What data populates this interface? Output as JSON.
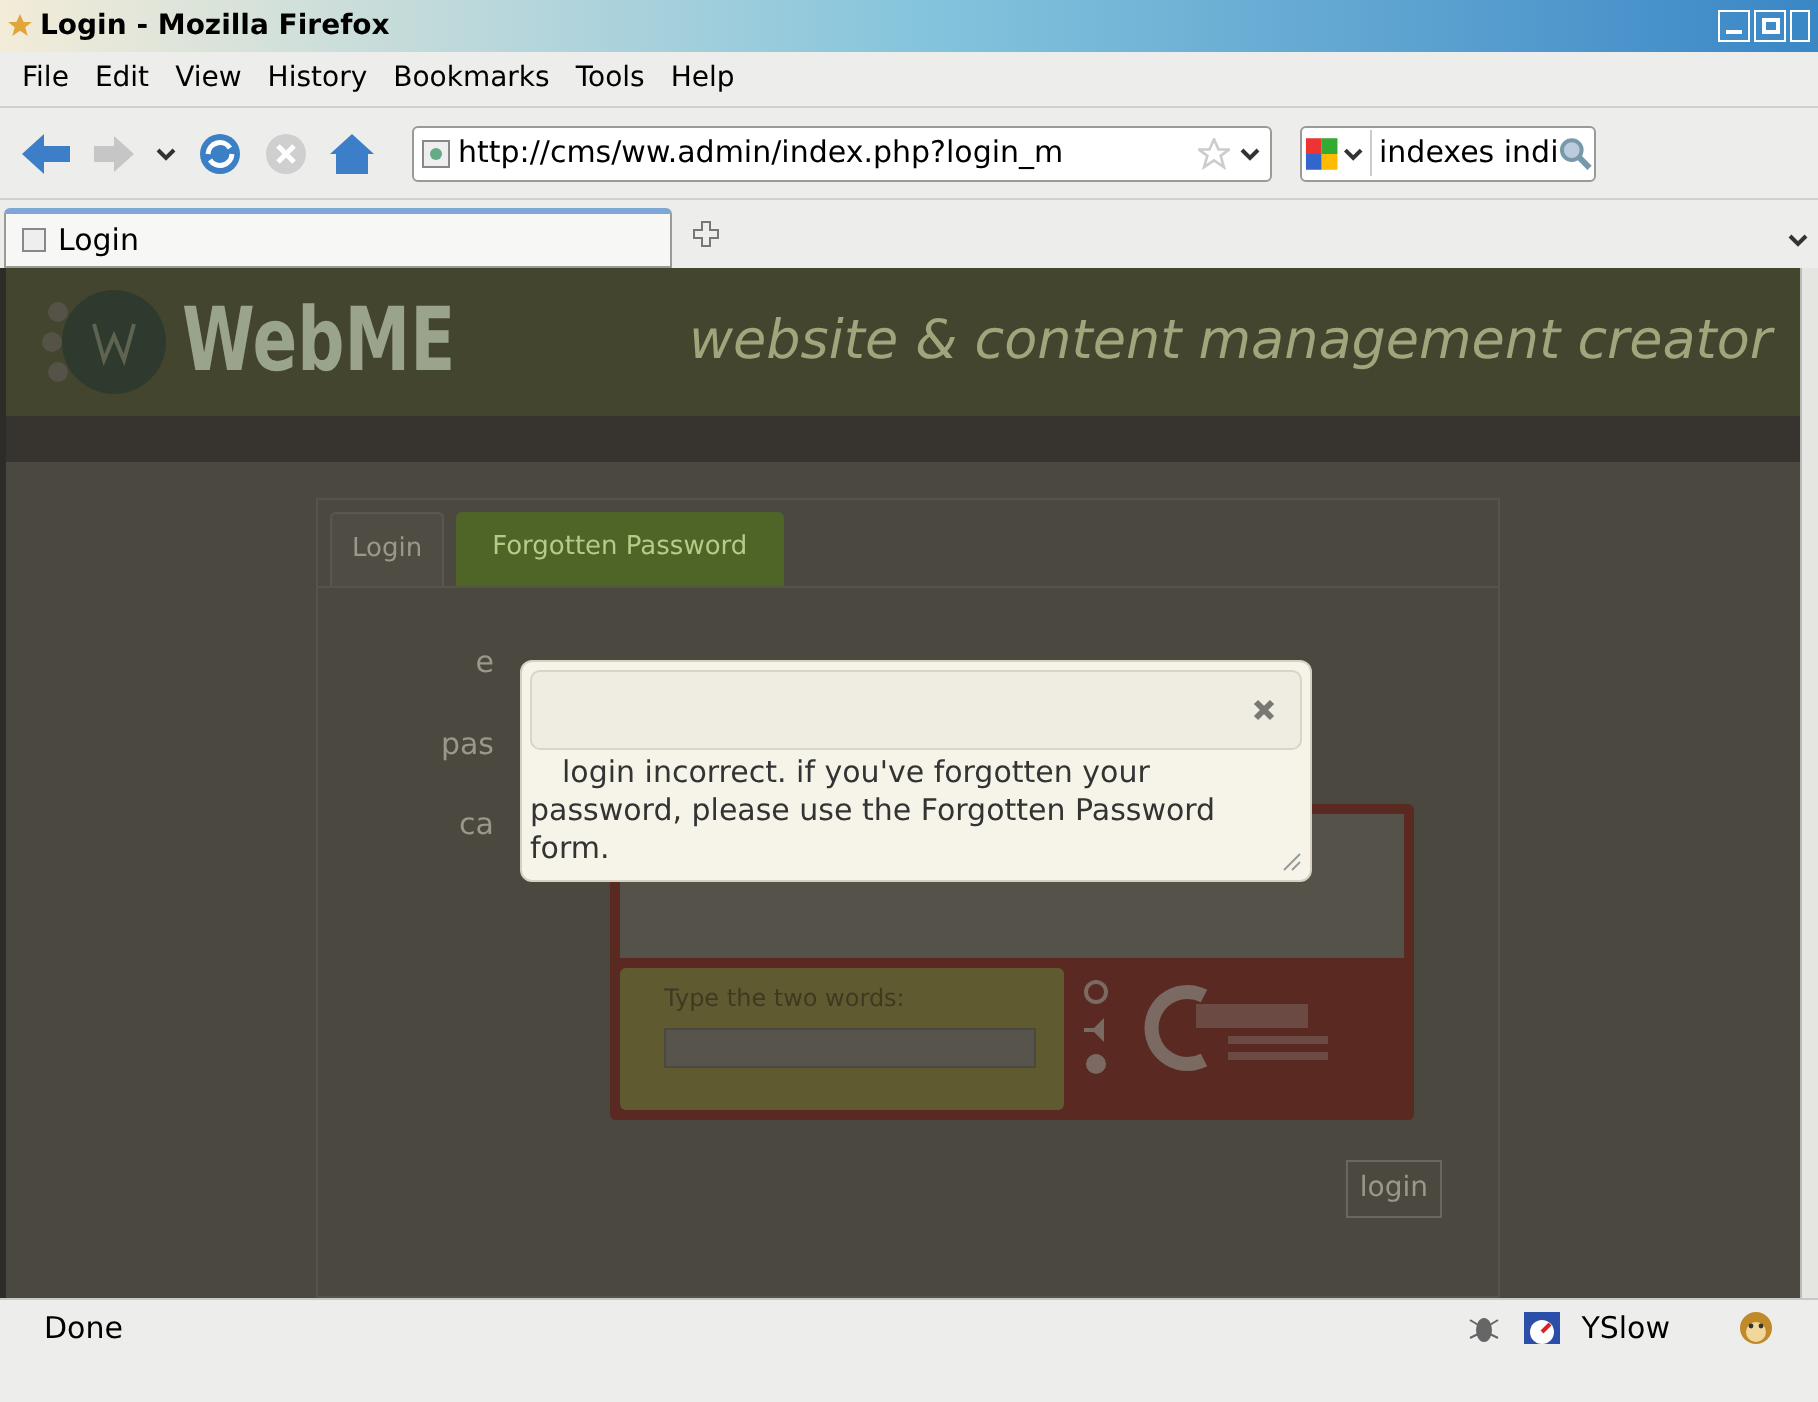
{
  "window": {
    "title": "Login - Mozilla Firefox"
  },
  "menu": [
    "File",
    "Edit",
    "View",
    "History",
    "Bookmarks",
    "Tools",
    "Help"
  ],
  "address_bar": {
    "value": "http://cms/ww.admin/index.php?login_m"
  },
  "search_bar": {
    "value": "indexes indi"
  },
  "tabs": [
    {
      "label": "Login",
      "selected": true
    }
  ],
  "page": {
    "logo": "WebME",
    "tagline": "website & content management creator",
    "tabs": [
      {
        "label": "Login",
        "selected": true
      },
      {
        "label": "Forgotten Password",
        "selected": false
      }
    ],
    "labels": [
      "e",
      "pas",
      "ca"
    ],
    "captcha_prompt": "Type the two words:",
    "login_button": "login"
  },
  "dialog": {
    "message": "login incorrect. if you've forgotten your password, please use the Forgotten Password form."
  },
  "status_bar": {
    "text": "Done",
    "yslow": "YSlow"
  }
}
